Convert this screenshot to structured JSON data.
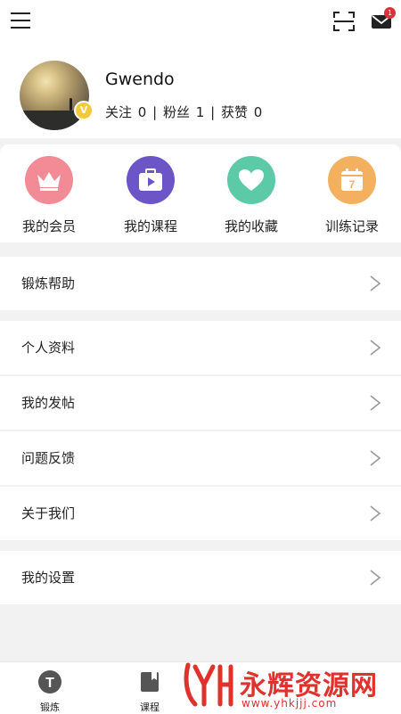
{
  "profile": {
    "username": "Gwendo",
    "vip_badge": "V",
    "stats": {
      "following_label": "关注",
      "following_value": "0",
      "separator": "|",
      "fans_label": "粉丝",
      "fans_value": "1",
      "likes_label": "获赞",
      "likes_value": "0"
    }
  },
  "header": {
    "mail_badge": "1"
  },
  "features": [
    {
      "label": "我的会员",
      "icon": "crown-icon",
      "color": "#f28b96"
    },
    {
      "label": "我的课程",
      "icon": "course-icon",
      "color": "#6b55c7"
    },
    {
      "label": "我的收藏",
      "icon": "heart-icon",
      "color": "#5cc9a7"
    },
    {
      "label": "训练记录",
      "icon": "calendar-icon",
      "color": "#f3b15f"
    }
  ],
  "calendar_day": "7",
  "menu": {
    "exercise_help": "锻炼帮助",
    "personal_info": "个人资料",
    "my_posts": "我的发帖",
    "feedback": "问题反馈",
    "about_us": "关于我们",
    "settings": "我的设置"
  },
  "bottom_nav": {
    "exercise": "锻炼",
    "exercise_icon_glyph": "T",
    "courses": "课程"
  },
  "watermark": {
    "brand": "永辉资源网",
    "url": "www.yhkjjj.com"
  }
}
